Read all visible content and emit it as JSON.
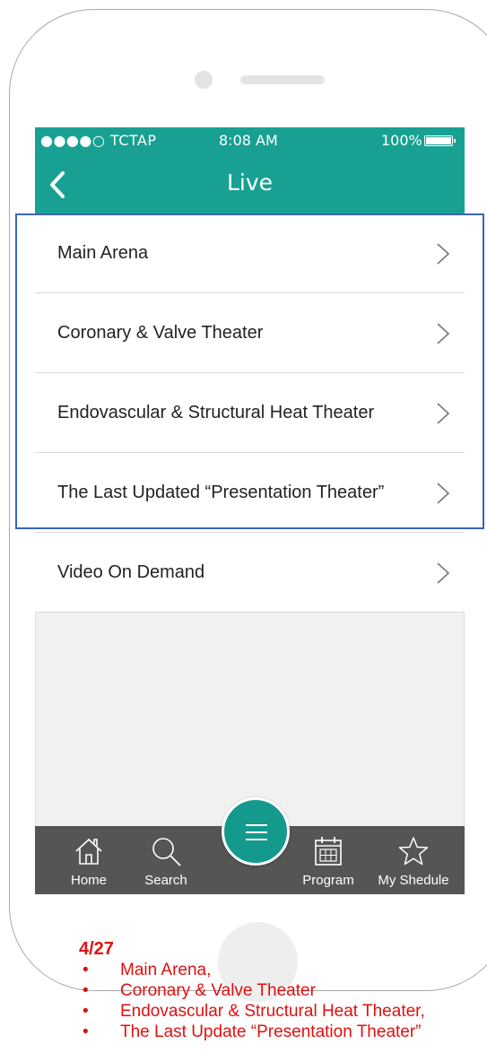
{
  "status_bar": {
    "carrier": "●●●●○ TCTAP",
    "time": "8:08 AM",
    "battery": "100%"
  },
  "header": {
    "title": "Live"
  },
  "menu": [
    {
      "label": "Main Arena"
    },
    {
      "label": "Coronary & Valve Theater"
    },
    {
      "label": "Endovascular & Structural Heat Theater"
    },
    {
      "label": "The Last Updated “Presentation Theater”"
    },
    {
      "label": "Video On Demand"
    }
  ],
  "tabbar": {
    "home": "Home",
    "search": "Search",
    "program": "Program",
    "my_schedule": "My Shedule"
  },
  "notes": {
    "date": "4/27",
    "items": [
      "Main Arena,",
      "Coronary & Valve Theater",
      "Endovascular & Structural Heat Theater,",
      "The Last Update “Presentation Theater”"
    ]
  },
  "colors": {
    "header": "#18a192",
    "tabbar": "#555555",
    "fab": "#139a8c",
    "highlight": "#3c63c4",
    "notes": "#e01010"
  }
}
